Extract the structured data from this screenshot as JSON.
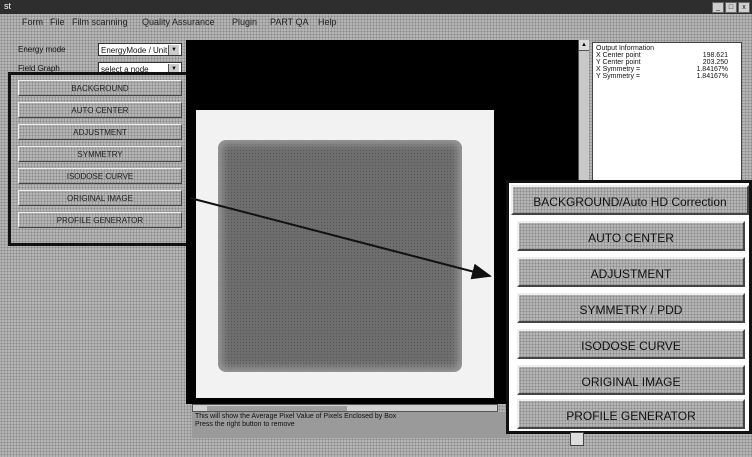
{
  "window": {
    "title": "st",
    "controls": [
      "_",
      "□",
      "x"
    ]
  },
  "menubar": {
    "items": [
      "Form",
      "File",
      "Film scanning",
      "Quality Assurance",
      "Plugin",
      "PART QA",
      "Help"
    ]
  },
  "left_panel": {
    "energy_label": "Energy mode",
    "energy_value": "EnergyMode / Unit",
    "field_label": "Field Graph",
    "field_value": "select a node",
    "buttons": [
      "BACKGROUND",
      "AUTO CENTER",
      "ADJUSTMENT",
      "SYMMETRY",
      "ISODOSE CURVE",
      "ORIGINAL IMAGE",
      "PROFILE GENERATOR"
    ]
  },
  "output": {
    "title": "Output Information",
    "rows": [
      {
        "key": "X Center point",
        "value": "198.621"
      },
      {
        "key": "Y Center point",
        "value": "203.250"
      },
      {
        "key": "X Symmetry =",
        "value": "1.84167%"
      },
      {
        "key": "Y Symmetry =",
        "value": "1.84167%"
      }
    ]
  },
  "status": {
    "line1": "This will show the Average Pixel Value of Pixels Enclosed by Box",
    "line2": "Press the right button to remove"
  },
  "zoom_panel": {
    "buttons": [
      "BACKGROUND/Auto HD Correction",
      "AUTO CENTER",
      "ADJUSTMENT",
      "SYMMETRY / PDD",
      "ISODOSE CURVE",
      "ORIGINAL IMAGE",
      "PROFILE GENERATOR"
    ]
  },
  "colors": {
    "panel_gray": "#b5b5b5",
    "canvas_black": "#000000",
    "highlight_border": "#111111"
  },
  "icons": {
    "dropdown_arrow": "triangle-down",
    "scroll_up": "triangle-up",
    "callout_arrow": "arrow-right"
  }
}
